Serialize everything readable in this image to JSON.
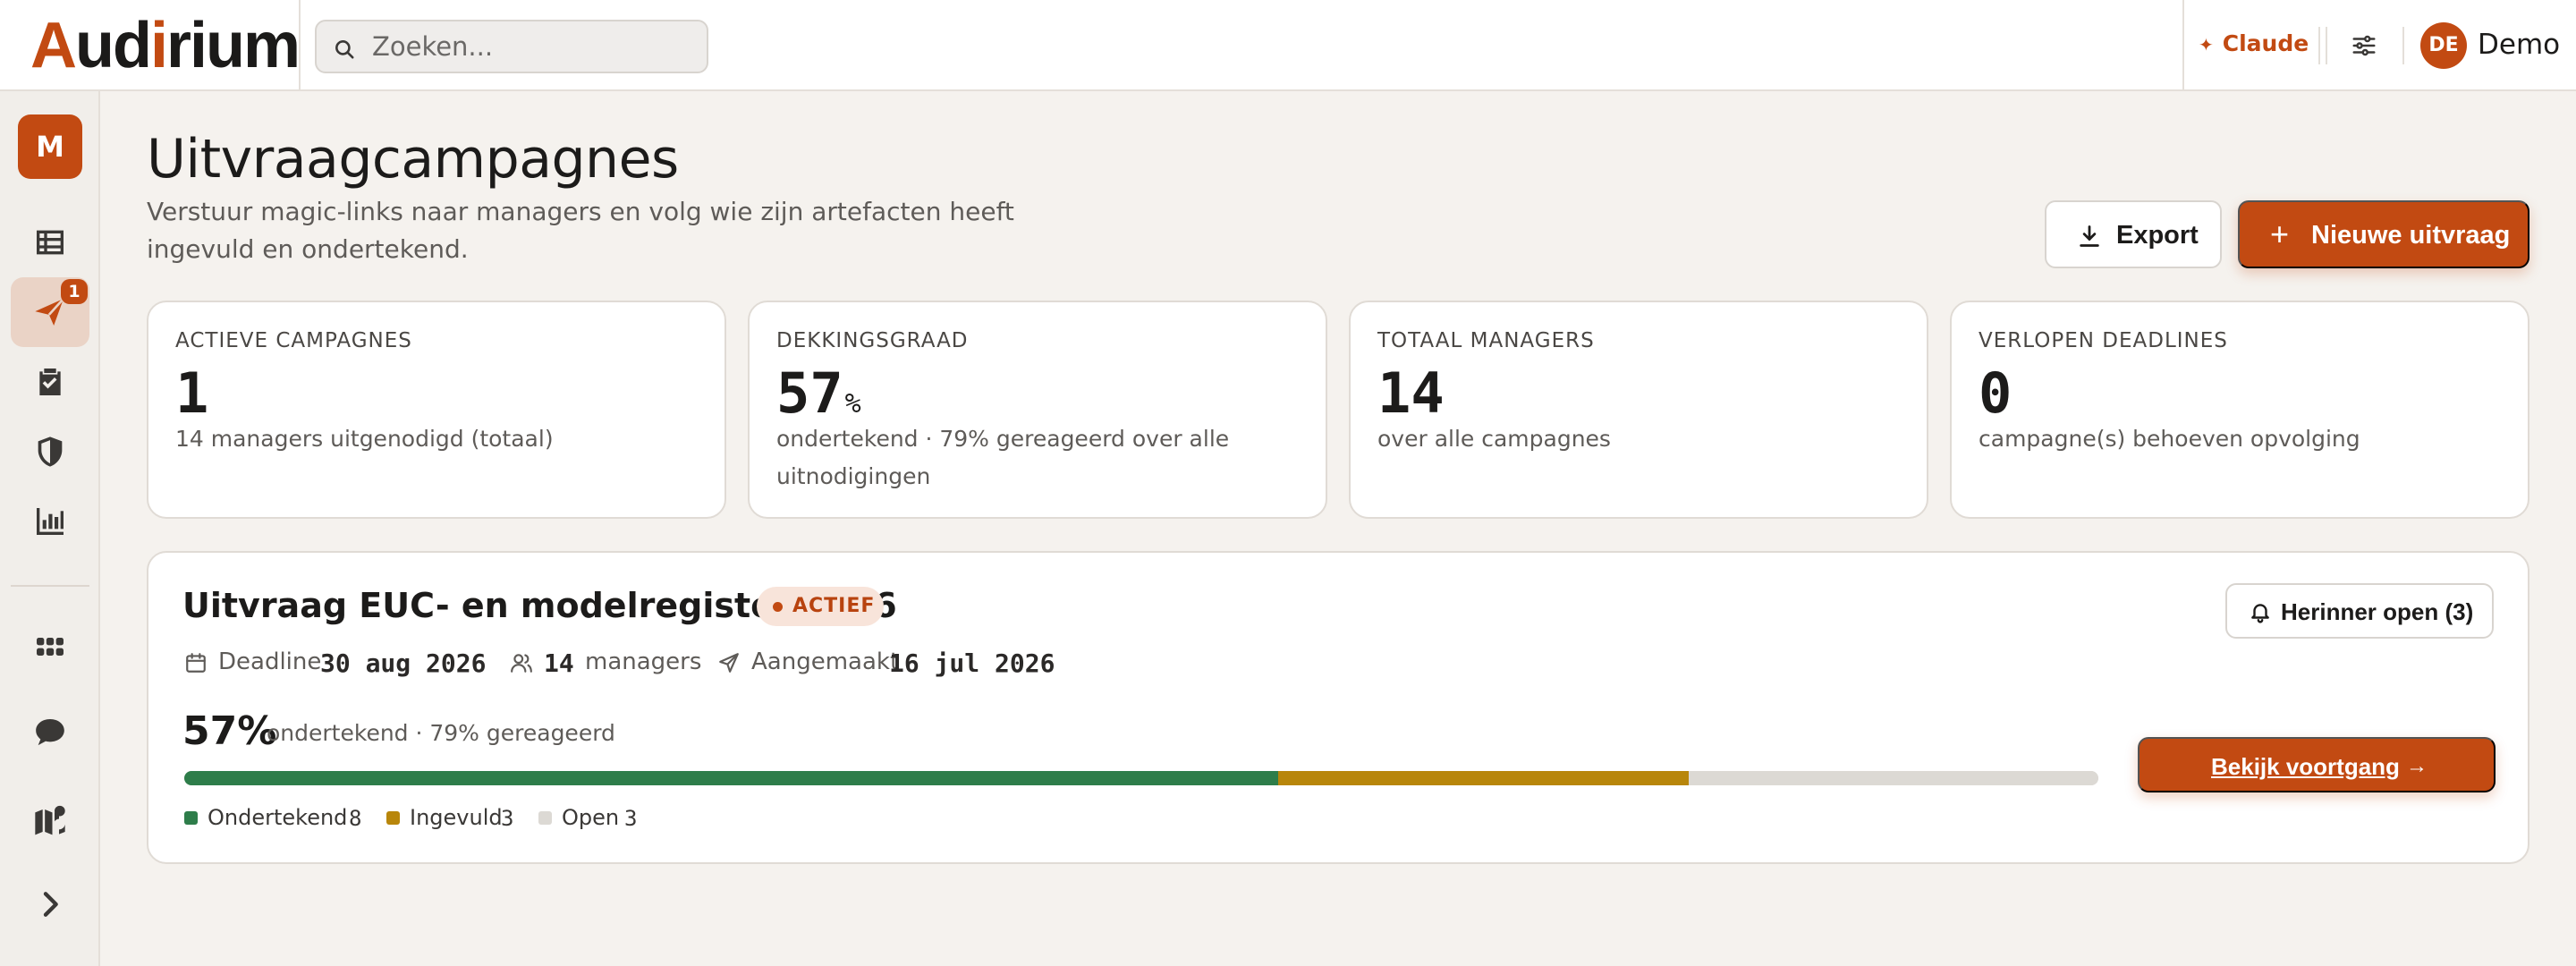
{
  "app": {
    "name": "Audirium"
  },
  "search": {
    "placeholder": "Zoeken..."
  },
  "header": {
    "assistant_label": "Claude",
    "user_initials": "DE",
    "user_name": "Demo"
  },
  "sidebar": {
    "workspace_initial": "M",
    "active_badge_count": "1",
    "items": [
      {
        "icon": "list-icon"
      },
      {
        "icon": "send-icon",
        "active": true
      },
      {
        "icon": "clipboard-check-icon"
      },
      {
        "icon": "shield-icon"
      },
      {
        "icon": "bar-chart-icon"
      },
      {
        "icon": "grid-icon"
      },
      {
        "icon": "chat-icon"
      },
      {
        "icon": "map-icon"
      },
      {
        "icon": "chevron-right-icon"
      }
    ]
  },
  "page": {
    "title": "Uitvraagcampagnes",
    "subtitle": "Verstuur magic-links naar managers en volg wie zijn artefacten heeft ingevuld en ondertekend.",
    "export_label": "Export",
    "new_label": "Nieuwe uitvraag"
  },
  "stats": [
    {
      "label": "Actieve campagnes",
      "value": "1",
      "unit": "",
      "sub": "14 managers uitgenodigd (totaal)"
    },
    {
      "label": "Dekkingsgraad",
      "value": "57",
      "unit": "%",
      "sub": "ondertekend · 79% gereageerd over alle uitnodigingen"
    },
    {
      "label": "Totaal managers",
      "value": "14",
      "unit": "",
      "sub": "over alle campagnes"
    },
    {
      "label": "Verlopen deadlines",
      "value": "0",
      "unit": "",
      "sub": "campagne(s) behoeven opvolging"
    }
  ],
  "campaign": {
    "title": "Uitvraag EUC- en modelregister 2026",
    "status": "ACTIEF",
    "remind_label": "Herinner open (3)",
    "deadline_label": "Deadline",
    "deadline_value": "30 aug 2026",
    "managers_value": "14",
    "managers_label": "managers",
    "created_label": "Aangemaakt",
    "created_value": "16 jul 2026",
    "percent": "57%",
    "percent_sub": "ondertekend · 79% gereageerd",
    "view_label": "Bekijk voortgang",
    "view_arrow": "→",
    "progress": {
      "total": 14,
      "segments": [
        {
          "label": "Ondertekend",
          "count": 8,
          "color": "#2e7d4a"
        },
        {
          "label": "Ingevuld",
          "count": 3,
          "color": "#b8860b"
        },
        {
          "label": "Open",
          "count": 3,
          "color": "#dcd9d4"
        }
      ]
    }
  },
  "colors": {
    "accent": "#c24a12",
    "background": "#f5f2ee",
    "signed": "#2e7d4a",
    "filled": "#b8860b",
    "open": "#dcd9d4"
  }
}
